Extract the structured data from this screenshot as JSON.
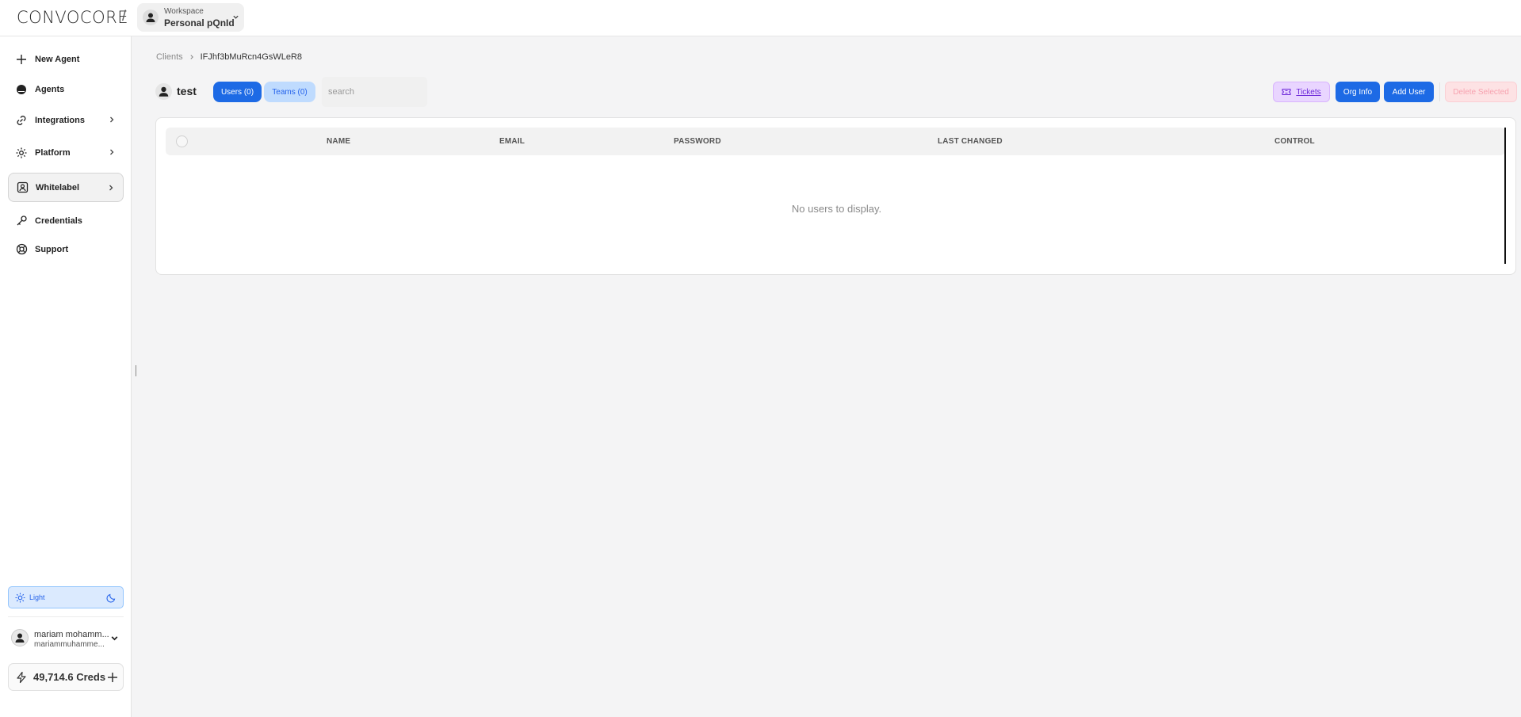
{
  "brand": {
    "logo_text": "CONVOCORE"
  },
  "workspace": {
    "caption": "Workspace",
    "name": "Personal pQnId"
  },
  "sidebar": {
    "items": [
      {
        "label": "New Agent",
        "icon": "plus-icon"
      },
      {
        "label": "Agents",
        "icon": "agent-icon"
      },
      {
        "label": "Integrations",
        "icon": "link-icon"
      },
      {
        "label": "Platform",
        "icon": "gear-icon"
      },
      {
        "label": "Whitelabel",
        "icon": "whitelabel-icon"
      },
      {
        "label": "Credentials",
        "icon": "key-icon"
      },
      {
        "label": "Support",
        "icon": "lifebuoy-icon"
      }
    ],
    "theme_label": "Light",
    "user": {
      "name": "mariam mohamm...",
      "email": "mariammuhamme..."
    },
    "credits": "49,714.6 Creds"
  },
  "breadcrumb": {
    "root": "Clients",
    "current": "IFJhf3bMuRcn4GsWLeR8"
  },
  "org": {
    "name": "test"
  },
  "tabs": {
    "users": "Users (0)",
    "teams": "Teams (0)"
  },
  "search": {
    "placeholder": "search",
    "value": ""
  },
  "actions": {
    "tickets": "Tickets",
    "org_info": "Org Info",
    "add_user": "Add User",
    "delete_selected": "Delete Selected"
  },
  "table": {
    "columns": [
      "NAME",
      "EMAIL",
      "PASSWORD",
      "LAST CHANGED",
      "CONTROL"
    ],
    "empty_message": "No users to display."
  },
  "colors": {
    "primary": "#1d6ae5",
    "tickets_bg": "#e9d5ff",
    "danger_bg": "#fde2e4"
  }
}
